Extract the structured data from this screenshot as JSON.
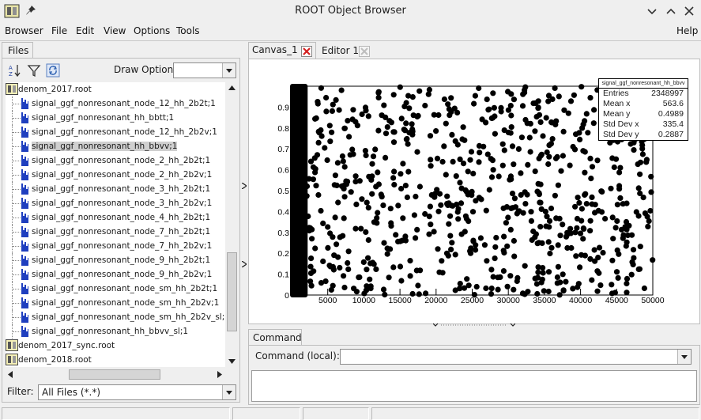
{
  "window": {
    "title": "ROOT Object Browser",
    "icons": [
      "root-app-icon",
      "pin-icon",
      "chevron-down-icon",
      "chevron-up-icon",
      "close-icon"
    ]
  },
  "menubar": {
    "browser": "Browser",
    "file": "File",
    "edit": "Edit",
    "view": "View",
    "options": "Options",
    "tools": "Tools",
    "help": "Help"
  },
  "left_panel": {
    "tab_label": "Files",
    "draw_option_label": "Draw Option:",
    "draw_option_value": "",
    "filter_label": "Filter:",
    "filter_value": "All Files (*.*)",
    "tree": [
      {
        "label": "denom_2017.root",
        "type": "file"
      },
      {
        "label": "signal_ggf_nonresonant_node_12_hh_2b2t;1",
        "type": "leaf"
      },
      {
        "label": "signal_ggf_nonresonant_hh_bbtt;1",
        "type": "leaf"
      },
      {
        "label": "signal_ggf_nonresonant_node_12_hh_2b2v;1",
        "type": "leaf"
      },
      {
        "label": "signal_ggf_nonresonant_hh_bbvv;1",
        "type": "leaf",
        "selected": true
      },
      {
        "label": "signal_ggf_nonresonant_node_2_hh_2b2t;1",
        "type": "leaf"
      },
      {
        "label": "signal_ggf_nonresonant_node_2_hh_2b2v;1",
        "type": "leaf"
      },
      {
        "label": "signal_ggf_nonresonant_node_3_hh_2b2t;1",
        "type": "leaf"
      },
      {
        "label": "signal_ggf_nonresonant_node_3_hh_2b2v;1",
        "type": "leaf"
      },
      {
        "label": "signal_ggf_nonresonant_node_4_hh_2b2t;1",
        "type": "leaf"
      },
      {
        "label": "signal_ggf_nonresonant_node_7_hh_2b2t;1",
        "type": "leaf"
      },
      {
        "label": "signal_ggf_nonresonant_node_7_hh_2b2v;1",
        "type": "leaf"
      },
      {
        "label": "signal_ggf_nonresonant_node_9_hh_2b2t;1",
        "type": "leaf"
      },
      {
        "label": "signal_ggf_nonresonant_node_9_hh_2b2v;1",
        "type": "leaf"
      },
      {
        "label": "signal_ggf_nonresonant_node_sm_hh_2b2t;1",
        "type": "leaf"
      },
      {
        "label": "signal_ggf_nonresonant_node_sm_hh_2b2v;1",
        "type": "leaf"
      },
      {
        "label": "signal_ggf_nonresonant_node_sm_hh_2b2v_sl;1",
        "type": "leaf"
      },
      {
        "label": "signal_ggf_nonresonant_hh_bbvv_sl;1",
        "type": "leaf"
      },
      {
        "label": "denom_2017_sync.root",
        "type": "file"
      },
      {
        "label": "denom_2018.root",
        "type": "file"
      }
    ]
  },
  "right_panel": {
    "tabs": [
      {
        "label": "Canvas_1",
        "active": true
      },
      {
        "label": "Editor 1",
        "active": false
      }
    ],
    "command_tab": "Command",
    "command_label": "Command (local):",
    "command_value": ""
  },
  "chart_data": {
    "type": "scatter",
    "title": "",
    "xlabel": "",
    "ylabel": "",
    "xlim": [
      0,
      50000
    ],
    "ylim": [
      0,
      1
    ],
    "x_ticks": [
      "5000",
      "10000",
      "15000",
      "20000",
      "25000",
      "30000",
      "35000",
      "40000",
      "45000",
      "50000"
    ],
    "y_ticks": [
      "0",
      "0.1",
      "0.2",
      "0.3",
      "0.4",
      "0.5",
      "0.6",
      "0.7",
      "0.8",
      "0.9"
    ],
    "dense_band_x": [
      0,
      2000
    ],
    "stats_box": {
      "name": "signal_ggf_nonresonant_hh_bbvv",
      "rows": [
        {
          "key": "Entries",
          "value": "2348997"
        },
        {
          "key": "Mean x",
          "value": "563.6"
        },
        {
          "key": "Mean y",
          "value": "0.4989"
        },
        {
          "key": "Std Dev x",
          "value": "335.4"
        },
        {
          "key": "Std Dev y",
          "value": "0.2887"
        }
      ]
    },
    "marker_color": "#000000"
  },
  "colors": {
    "selection": "#cfcfcf",
    "leaf_icon": "#1f3fbf",
    "close_red": "#d42020"
  }
}
